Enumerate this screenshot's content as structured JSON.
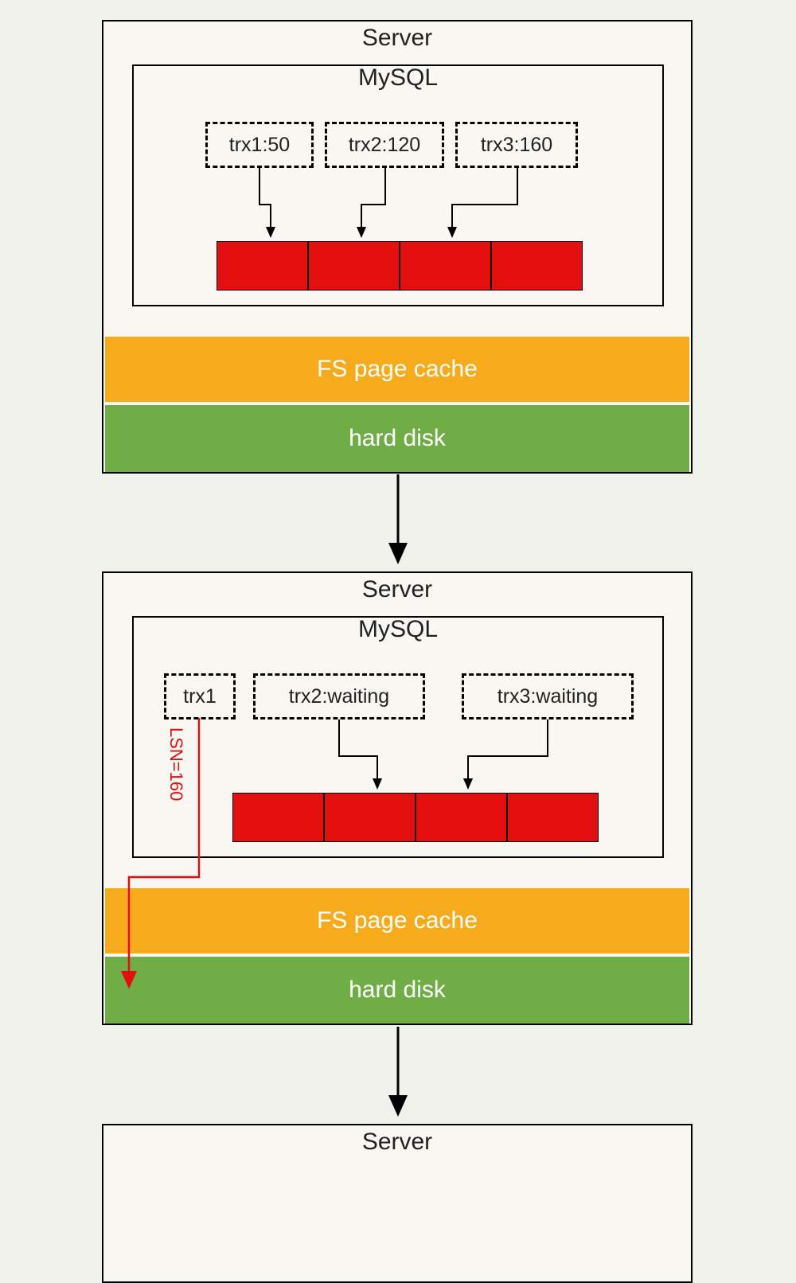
{
  "diagram": {
    "server1": {
      "title": "Server",
      "mysql_title": "MySQL",
      "trx1": "trx1:50",
      "trx2": "trx2:120",
      "trx3": "trx3:160",
      "cache_label": "FS page cache",
      "disk_label": "hard disk"
    },
    "server2": {
      "title": "Server",
      "mysql_title": "MySQL",
      "trx1": "trx1",
      "trx2": "trx2:waiting",
      "trx3": "trx3:waiting",
      "cache_label": "FS page cache",
      "disk_label": "hard disk",
      "lsn_label": "LSN=160"
    },
    "server3": {
      "title": "Server"
    }
  }
}
